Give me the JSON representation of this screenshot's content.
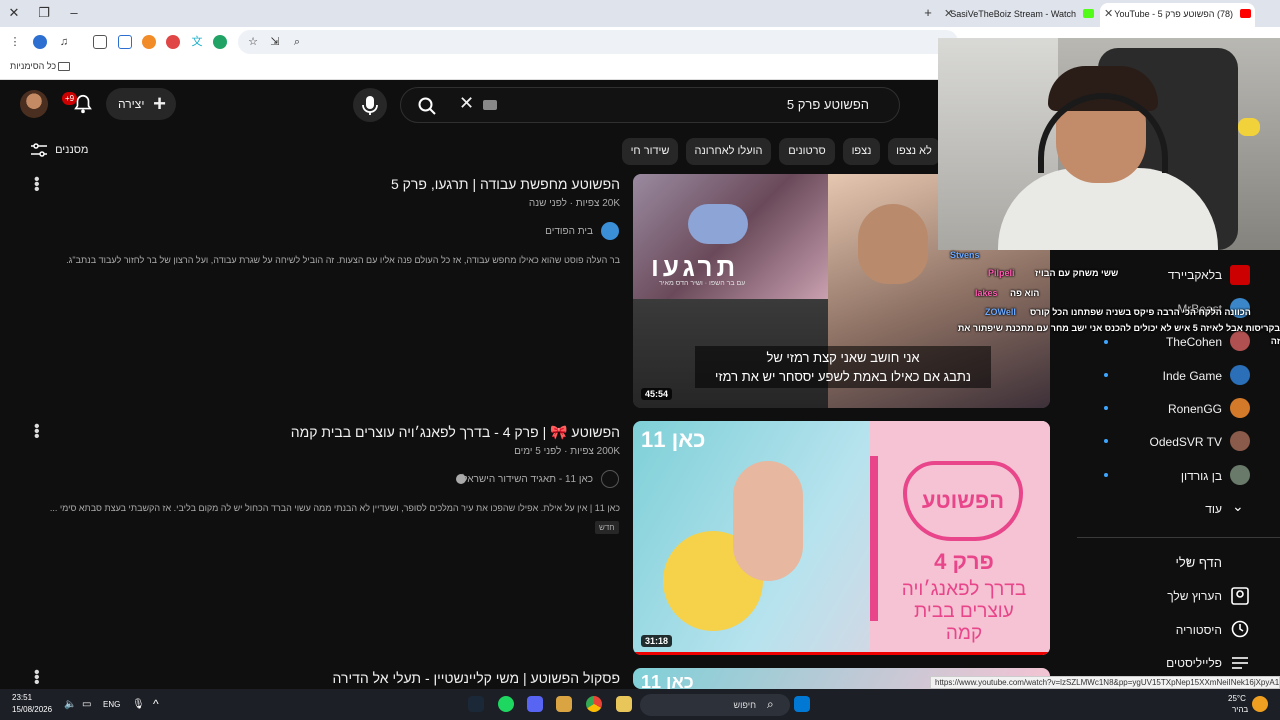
{
  "browser": {
    "tabs": [
      {
        "title": "SasiVeTheBoiz Stream - Watch",
        "active": false
      },
      {
        "title": "(78) הפשוטע פרק 5 - YouTube",
        "active": true
      }
    ],
    "bookmarks_label": "כל הסימניות",
    "status_url": "https://www.youtube.com/watch?v=lzSZLMWc1N8&pp=ygUV15TXpNep15XXmNeiINek16jXpyA1"
  },
  "youtube": {
    "notifications_badge": "+9",
    "create_label": "יצירה",
    "search_query": "הפשוטע פרק 5",
    "filters_label": "מסננים",
    "chips": [
      "לא נצפו",
      "נצפו",
      "סרטונים",
      "הועלו לאחרונה",
      "שידור חי"
    ],
    "results": [
      {
        "title": "הפשוטע מחפשת עבודה | תרגעו, פרק 5",
        "meta": "20K צפיות · לפני שנה",
        "channel": "בית הפודים",
        "description": "בר העלה פוסט שהוא כאילו מחפש עבודה, אז כל העולם פנה אליו עם הצעות. זה הוביל לשיחה על שגרת עבודה, ועל הרצון של בר לחזור לעבוד בנתב\"ג.",
        "duration": "45:54",
        "thumb_title": "תרגעו",
        "thumb_subtitle": "עם בר השפו · ושיר הדס מאיר",
        "thumb_caption_1": "אני חושב שאני קצת רמזי של",
        "thumb_caption_2": "נתבג אם כאילו באמת לשפע יססחר יש את רמזי"
      },
      {
        "title": "הפשוטע 🎀 | פרק 4 - בדרך לפאנג׳ויה עוצרים בבית קמה",
        "meta": "200K צפיות · לפני 5 ימים",
        "channel": "כאן 11 - תאגיד השידור הישראלי",
        "description": "כאן 11 | אין על אילת. אפילו שהפכו את עיר המלכים לסופר, ושעדיין לא הבנתי ממה עשוי הברד הכחול יש לה מקום בליבי. אז הקשבתי בעצת סבתא סימי ...",
        "new_tag": "חדש",
        "duration": "31:18",
        "thumb_logo": "כאן 11",
        "thumb_show": "הפשוטע",
        "thumb_ep": "פרק 4",
        "thumb_line1": "בדרך לפאנג׳ויה",
        "thumb_line2": "עוצרים בבית",
        "thumb_line3": "קמה"
      },
      {
        "title": "פסקול הפשוטע | משי קליינשטיין - תעלי אל הדירה",
        "thumb_logo": "כאן 11"
      }
    ],
    "sidebar": {
      "subs": [
        {
          "name": "בלאקביירד",
          "icon_color": "#c00"
        },
        {
          "name": "MrBeast",
          "icon_color": "#3a86c8"
        },
        {
          "name": "TheCohen",
          "icon_color": "#b05050"
        },
        {
          "name": "Inde Game",
          "icon_color": "#2a6fb8"
        },
        {
          "name": "RonenGG",
          "icon_color": "#d27a2a"
        },
        {
          "name": "OdedSVR TV",
          "icon_color": "#8a5a4a"
        },
        {
          "name": "בן גורדון",
          "icon_color": "#6a7a6a"
        }
      ],
      "more_label": "עוד",
      "you_label": "הדף שלי",
      "you_items": [
        "הערוץ שלך",
        "היסטוריה",
        "פלייליסטים"
      ]
    }
  },
  "stream_chat": [
    {
      "user": "Stvens",
      "text": ""
    },
    {
      "user": "Pilpeli",
      "text": "ששי משחק עם הבויז"
    },
    {
      "user": "lakes",
      "text": "הוא פה"
    },
    {
      "user": "ZOWell",
      "text": "הכוונה הלקח הכי הרבה פיקס בשניה שפתחנו הכל קורס"
    },
    {
      "user": "",
      "text": "בקריסות אבל לאיזה 5 איש לא יכולים להכנס אני ישב מחר עם מתכנת שיפתור את זה"
    }
  ],
  "taskbar": {
    "time": "23:51",
    "date": "15/08/2026",
    "lang": "ENG",
    "search_label": "חיפוש",
    "weather_temp": "25°C",
    "weather_desc": "בהיר"
  }
}
